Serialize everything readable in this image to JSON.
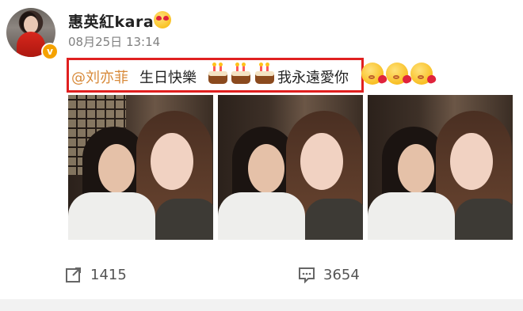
{
  "post": {
    "username": "惠英紅kara",
    "time": "08月25日 13:14",
    "mention": "@刘亦菲",
    "text_a": "生日快樂",
    "text_b": "我永遠愛你",
    "cake_emoji_count": 3,
    "kiss_emoji_count": 3,
    "photos": [
      "photo-1",
      "photo-2",
      "photo-3"
    ]
  },
  "actions": {
    "repost_count": "1415",
    "comment_count": "3654"
  },
  "colors": {
    "mention": "#d88a3a",
    "highlight_border": "#e02020",
    "verified_badge": "#f5a200"
  }
}
